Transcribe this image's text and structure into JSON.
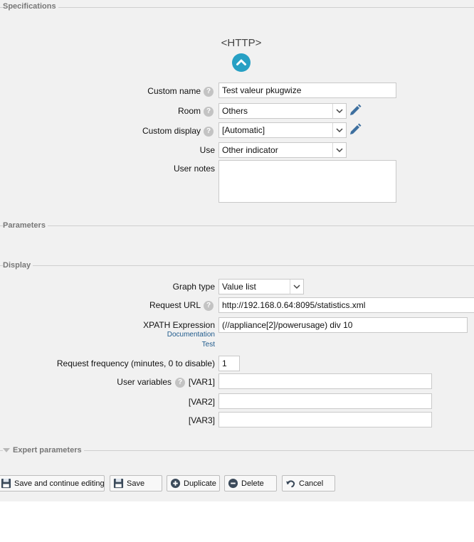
{
  "sections": {
    "specifications": "Specifications",
    "parameters": "Parameters",
    "display": "Display",
    "expert": "Expert parameters"
  },
  "header": {
    "title": "<HTTP>",
    "collapse_icon": "chevron-up-circle-icon"
  },
  "help_glyph": "?",
  "fields": {
    "custom_name": {
      "label": "Custom name",
      "value": "Test valeur pkugwize"
    },
    "room": {
      "label": "Room",
      "value": "Others"
    },
    "custom_display": {
      "label": "Custom display",
      "value": "[Automatic]"
    },
    "use": {
      "label": "Use",
      "value": "Other indicator"
    },
    "user_notes": {
      "label": "User notes",
      "value": ""
    },
    "graph_type": {
      "label": "Graph type",
      "value": "Value list"
    },
    "request_url": {
      "label": "Request URL",
      "value": "http://192.168.0.64:8095/statistics.xml"
    },
    "xpath": {
      "label": "XPATH Expression",
      "value": "(//appliance[2]/powerusage) div 10",
      "link_documentation": "Documentation",
      "link_test": "Test"
    },
    "frequency": {
      "label": "Request frequency (minutes, 0 to disable)",
      "value": "1"
    },
    "user_variables": {
      "label": "User variables"
    },
    "var1": {
      "label": "[VAR1]",
      "value": ""
    },
    "var2": {
      "label": "[VAR2]",
      "value": ""
    },
    "var3": {
      "label": "[VAR3]",
      "value": ""
    }
  },
  "buttons": {
    "save_continue": "Save and continue editing",
    "save": "Save",
    "duplicate": "Duplicate",
    "delete": "Delete",
    "cancel": "Cancel"
  },
  "colors": {
    "accent": "#27a0c4",
    "pencil": "#3d6f9f",
    "link": "#1f5a8c"
  }
}
